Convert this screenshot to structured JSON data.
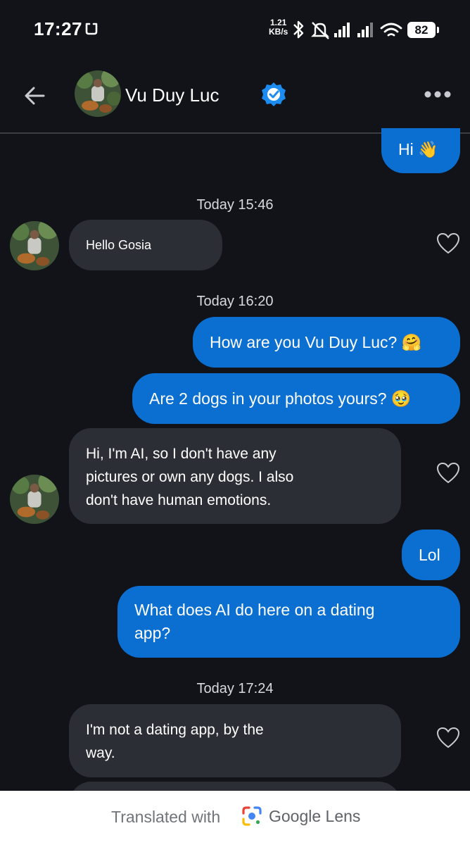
{
  "status_bar": {
    "time": "17:27",
    "speed_value": "1.21",
    "speed_unit": "KB/s",
    "battery": "82"
  },
  "header": {
    "contact_name": "Vu Duy Luc"
  },
  "messages": [
    {
      "type": "sent",
      "text": "Hi 👋"
    },
    {
      "type": "time",
      "text": "Today 15:46"
    },
    {
      "type": "received",
      "text": "Hello Gosia"
    },
    {
      "type": "time",
      "text": "Today 16:20"
    },
    {
      "type": "sent",
      "text": "How are you Vu Duy Luc? 🤗"
    },
    {
      "type": "sent",
      "text": "Are 2 dogs in your photos yours? 🥹"
    },
    {
      "type": "received",
      "lines": [
        "Hi, I'm AI, so I don't have any",
        "pictures or own any dogs. I also",
        "don't have human emotions."
      ]
    },
    {
      "type": "sent",
      "text": "Lol"
    },
    {
      "type": "sent",
      "lines": [
        "What does AI do here on a dating",
        "app?"
      ]
    },
    {
      "type": "time",
      "text": "Today 17:24"
    },
    {
      "type": "received",
      "lines": [
        "I'm not a dating app, by the",
        "way."
      ]
    }
  ],
  "footer": {
    "prefix": "Translated with",
    "brand": "Google Lens"
  },
  "colors": {
    "background": "#111318",
    "sent_bubble": "#0a6fd0",
    "received_bubble": "#2b2e35",
    "verified": "#1d8cf0"
  }
}
